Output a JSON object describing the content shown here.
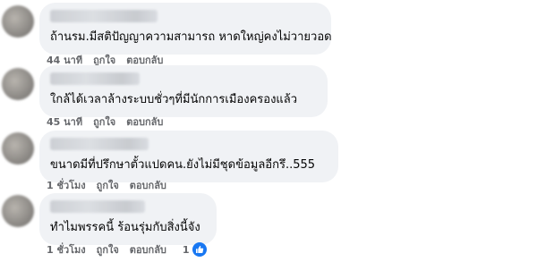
{
  "comments": [
    {
      "text": "ถ้านรม.มีสติปัญญาความสามารถ หาดใหญ่คงไม่วายวอด",
      "time": "44 นาที",
      "like_label": "ถูกใจ",
      "reply_label": "ตอบกลับ"
    },
    {
      "text": "ใกล้ได้เวลาล้างระบบชั่วๆที่มีนักการเมืองครองแล้ว",
      "time": "45 นาที",
      "like_label": "ถูกใจ",
      "reply_label": "ตอบกลับ"
    },
    {
      "text": "ขนาดมีที่ปรึกษาตั้วแปดคน.ยังไม่มีชุดข้อมูลอีกรึ..555",
      "time": "1 ชั่วโมง",
      "like_label": "ถูกใจ",
      "reply_label": "ตอบกลับ"
    },
    {
      "text": "ทำไมพรรคนี้ ร้อนรุ่มกับสิ่งนี้จัง",
      "time": "1 ชั่วโมง",
      "like_label": "ถูกใจ",
      "reply_label": "ตอบกลับ",
      "reaction_count": "1",
      "reaction_icon": "like-icon"
    }
  ],
  "colors": {
    "bubble": "#f0f2f5",
    "meta_text": "#65676b",
    "like_blue": "#1877f2"
  }
}
